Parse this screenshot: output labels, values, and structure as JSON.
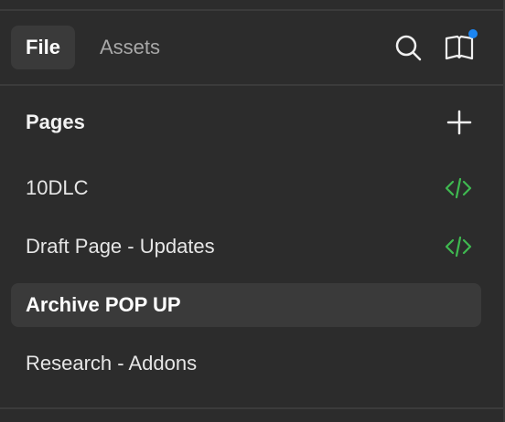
{
  "header": {
    "tabs": [
      {
        "label": "File",
        "active": true
      },
      {
        "label": "Assets",
        "active": false
      }
    ],
    "icons": [
      "search-icon",
      "library-book-icon"
    ],
    "notification_dot_color": "#1c86f2"
  },
  "pages": {
    "title": "Pages",
    "add_icon": "plus-icon",
    "items": [
      {
        "label": "10DLC",
        "has_code": true,
        "selected": false
      },
      {
        "label": "Draft Page - Updates",
        "has_code": true,
        "selected": false
      },
      {
        "label": "Archive POP UP",
        "has_code": false,
        "selected": true
      },
      {
        "label": "Research - Addons",
        "has_code": false,
        "selected": false
      }
    ]
  },
  "colors": {
    "background": "#2c2c2c",
    "selected_row": "#3a3a3a",
    "code_icon": "#3fb950",
    "accent": "#1c86f2"
  }
}
